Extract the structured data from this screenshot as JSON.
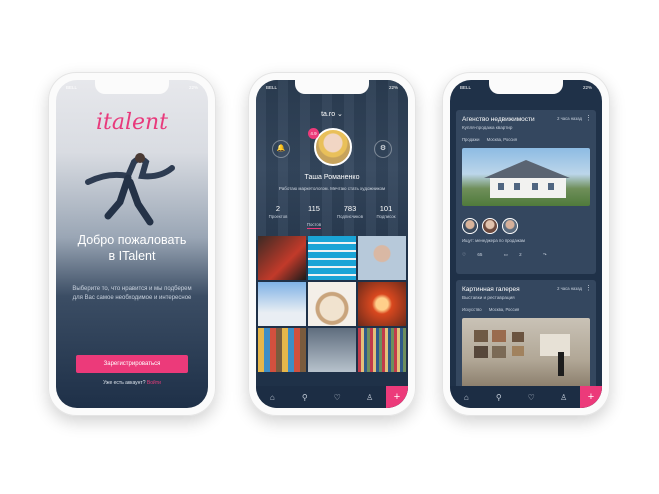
{
  "colors": {
    "accent": "#ec3a7a",
    "background": "#1f3148",
    "card": "#34475f"
  },
  "status": {
    "carrier": "BELL",
    "battery": "22%"
  },
  "welcome": {
    "logo": "italent",
    "title_line1": "Добро пожаловать",
    "title_line2": "в ITalent",
    "description": "Выберите то, что нравится и мы подберем для Вас самое необходимое и интересное",
    "register_button": "Зарегистрироваться",
    "have_account": "Уже есть аккаунт?",
    "login_link": "Войти"
  },
  "profile": {
    "username": "ta.ro",
    "rating": "4.9",
    "name": "Таша Романенко",
    "bio": "Работаю маркетологом. Мечтаю стать художником",
    "stats": [
      {
        "value": "2",
        "label": "Проектов"
      },
      {
        "value": "115",
        "label": "Постов"
      },
      {
        "value": "783",
        "label": "Подписчиков"
      },
      {
        "value": "101",
        "label": "Подписок"
      }
    ],
    "tabbar": {
      "icons": [
        "home-icon",
        "search-icon",
        "heart-icon",
        "user-icon"
      ],
      "plus": "+"
    }
  },
  "feed": {
    "cards": [
      {
        "title": "Агенство недвижимости",
        "subtitle": "Купля-продажа квартир",
        "time": "2 часа назад",
        "category": "Продажи",
        "location": "Москва, Россия",
        "needs": "Ищут: менеджера по продажам",
        "likes": "65",
        "comments": "2"
      },
      {
        "title": "Картинная галерея",
        "subtitle": "Выставки и реставрация",
        "time": "2 часа назад",
        "category": "Искусство",
        "location": "Москва, Россия"
      }
    ],
    "tabbar": {
      "plus": "+"
    }
  }
}
